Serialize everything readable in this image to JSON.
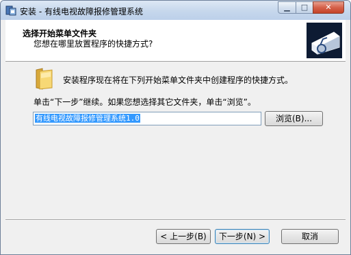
{
  "window": {
    "title": "安装 - 有线电视故障报修管理系统",
    "controls": {
      "minimize_icon": "minimize-icon",
      "maximize_icon": "maximize-icon",
      "close_icon": "close-icon"
    }
  },
  "header": {
    "title": "选择开始菜单文件夹",
    "subtitle": "您想在哪里放置程序的快捷方式?"
  },
  "body": {
    "info": "安装程序现在将在下列开始菜单文件夹中创建程序的快捷方式。",
    "hint": "单击“下一步”继续。如果您想选择其它文件夹，单击“浏览”。",
    "folder_value": "有线电视故障报修管理系统1.0",
    "browse_label": "浏览(B)..."
  },
  "footer": {
    "back_label": "< 上一步(B)",
    "next_label": "下一步(N) >",
    "cancel_label": "取消"
  },
  "colors": {
    "selection": "#3399ff",
    "titlebar": "#c6d7ec",
    "close_button": "#c44429"
  }
}
